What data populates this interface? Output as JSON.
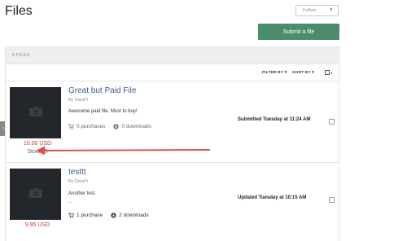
{
  "page": {
    "title": "Files"
  },
  "header": {
    "follow_label": "Follow",
    "follow_caret": "⬍",
    "submit_label": "Submit a file"
  },
  "panel": {
    "count_label": "6 FILES",
    "filter_label": "FILTER BY ▾",
    "sort_label": "SORT BY ▾",
    "select_caret": "▾"
  },
  "files": [
    {
      "title": "Great but Paid File",
      "author": "By DawPi",
      "description": "Awesome paid file. Must to buy!",
      "description_extra": "",
      "purchases": "0 purchases",
      "downloads": "0 downloads",
      "price": "10.00 USD",
      "stock": "Stock: 5",
      "status": "Submitted Tuesday at 11:24 AM"
    },
    {
      "title": "testtt",
      "author": "By DawPi",
      "description": "Another test.",
      "description_extra": "...",
      "purchases": "1 purchase",
      "downloads": "2 downloads",
      "price": "9.95 USD",
      "stock": "",
      "status": "Updated Tuesday at 10:15 AM"
    }
  ],
  "colors": {
    "accent": "#4c8c6e",
    "price": "#cc3333",
    "title_link": "#3a5d8a",
    "annotation_arrow": "#d9534f"
  },
  "icons": {
    "thumbnail": "camera-icon",
    "purchases": "cart-icon",
    "downloads": "download-circle-icon",
    "side_tab": "chevron-right-icon"
  }
}
